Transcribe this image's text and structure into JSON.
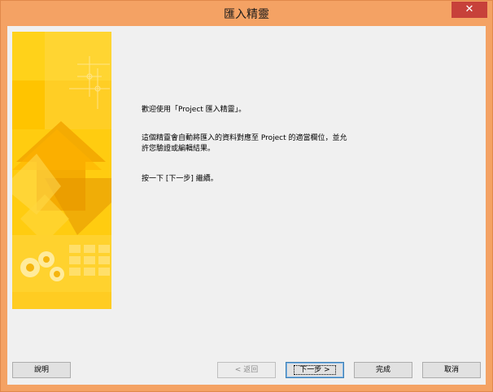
{
  "window": {
    "title": "匯入精靈",
    "close_glyph": "✕"
  },
  "content": {
    "welcome": "歡迎使用「Project 匯入精靈」。",
    "description": "這個精靈會自動將匯入的資料對應至 Project 的適當欄位，並允許您驗證或編輯結果。",
    "instruction": "按一下 [下一步] 繼續。"
  },
  "buttons": {
    "help": "說明",
    "back": "< 返回",
    "next": "下一步 >",
    "finish": "完成",
    "cancel": "取消"
  },
  "colors": {
    "window_frame": "#f4a264",
    "close_button": "#c7413a",
    "banner_primary": "#ffc800",
    "banner_light": "#ffe680"
  },
  "icons": {
    "banner_art": "wizard-banner-image"
  }
}
